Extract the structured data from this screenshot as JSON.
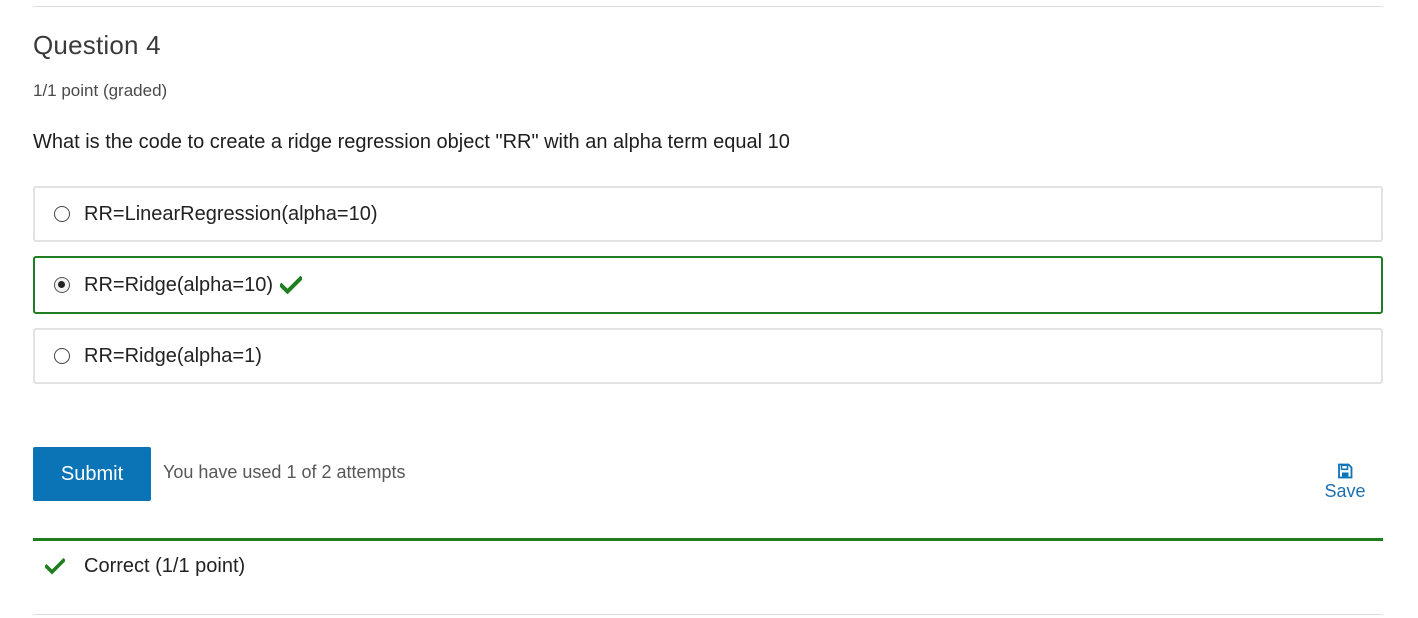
{
  "question": {
    "title": "Question 4",
    "points": "1/1 point (graded)",
    "prompt": "What is the code to create a ridge regression object \"RR\" with an alpha term equal 10"
  },
  "options": [
    {
      "label": "RR=LinearRegression(alpha=10)",
      "selected": false,
      "correct": false
    },
    {
      "label": "RR=Ridge(alpha=10)",
      "selected": true,
      "correct": true
    },
    {
      "label": "RR=Ridge(alpha=1)",
      "selected": false,
      "correct": false
    }
  ],
  "actions": {
    "submit_label": "Submit",
    "attempts_text": "You have used 1 of 2 attempts",
    "save_label": "Save",
    "save_icon": "floppy-disk-icon"
  },
  "result": {
    "text": "Correct (1/1 point)",
    "icon": "check-icon"
  },
  "colors": {
    "accent": "#0b74b6",
    "correct": "#1f7e1f"
  }
}
